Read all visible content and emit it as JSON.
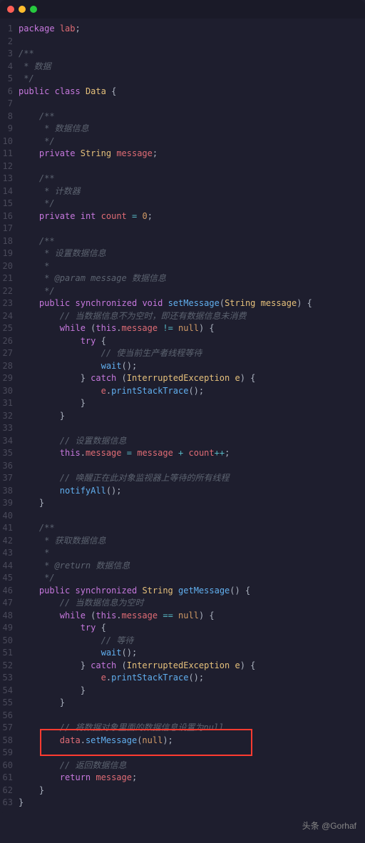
{
  "titlebar": {
    "close": "red",
    "min": "yellow",
    "max": "green"
  },
  "footer": {
    "source": "头条",
    "handle": "@Gorhaf"
  },
  "lines": [
    {
      "n": 1,
      "t": [
        [
          "kw",
          "package"
        ],
        [
          "",
          " "
        ],
        [
          "ident",
          "lab"
        ],
        [
          "punc",
          ";"
        ]
      ]
    },
    {
      "n": 2,
      "t": []
    },
    {
      "n": 3,
      "t": [
        [
          "cmt",
          "/**"
        ]
      ]
    },
    {
      "n": 4,
      "t": [
        [
          "cmt",
          " * 数据"
        ]
      ]
    },
    {
      "n": 5,
      "t": [
        [
          "cmt",
          " */"
        ]
      ]
    },
    {
      "n": 6,
      "t": [
        [
          "kw",
          "public"
        ],
        [
          "",
          " "
        ],
        [
          "kw",
          "class"
        ],
        [
          "",
          " "
        ],
        [
          "cls",
          "Data"
        ],
        [
          "punc",
          " {"
        ]
      ]
    },
    {
      "n": 7,
      "t": []
    },
    {
      "n": 8,
      "t": [
        [
          "",
          "    "
        ],
        [
          "cmt",
          "/**"
        ]
      ]
    },
    {
      "n": 9,
      "t": [
        [
          "",
          "    "
        ],
        [
          "cmt",
          " * 数据信息"
        ]
      ]
    },
    {
      "n": 10,
      "t": [
        [
          "",
          "    "
        ],
        [
          "cmt",
          " */"
        ]
      ]
    },
    {
      "n": 11,
      "t": [
        [
          "",
          "    "
        ],
        [
          "kw",
          "private"
        ],
        [
          "",
          " "
        ],
        [
          "typ",
          "String"
        ],
        [
          "",
          " "
        ],
        [
          "var",
          "message"
        ],
        [
          "punc",
          ";"
        ]
      ]
    },
    {
      "n": 12,
      "t": []
    },
    {
      "n": 13,
      "t": [
        [
          "",
          "    "
        ],
        [
          "cmt",
          "/**"
        ]
      ]
    },
    {
      "n": 14,
      "t": [
        [
          "",
          "    "
        ],
        [
          "cmt",
          " * 计数器"
        ]
      ]
    },
    {
      "n": 15,
      "t": [
        [
          "",
          "    "
        ],
        [
          "cmt",
          " */"
        ]
      ]
    },
    {
      "n": 16,
      "t": [
        [
          "",
          "    "
        ],
        [
          "kw",
          "private"
        ],
        [
          "",
          " "
        ],
        [
          "kw",
          "int"
        ],
        [
          "",
          " "
        ],
        [
          "var",
          "count"
        ],
        [
          "",
          " "
        ],
        [
          "op",
          "="
        ],
        [
          "",
          " "
        ],
        [
          "num",
          "0"
        ],
        [
          "punc",
          ";"
        ]
      ]
    },
    {
      "n": 17,
      "t": []
    },
    {
      "n": 18,
      "t": [
        [
          "",
          "    "
        ],
        [
          "cmt",
          "/**"
        ]
      ]
    },
    {
      "n": 19,
      "t": [
        [
          "",
          "    "
        ],
        [
          "cmt",
          " * 设置数据信息"
        ]
      ]
    },
    {
      "n": 20,
      "t": [
        [
          "",
          "    "
        ],
        [
          "cmt",
          " *"
        ]
      ]
    },
    {
      "n": 21,
      "t": [
        [
          "",
          "    "
        ],
        [
          "cmt",
          " * @param message 数据信息"
        ]
      ]
    },
    {
      "n": 22,
      "t": [
        [
          "",
          "    "
        ],
        [
          "cmt",
          " */"
        ]
      ]
    },
    {
      "n": 23,
      "t": [
        [
          "",
          "    "
        ],
        [
          "kw",
          "public"
        ],
        [
          "",
          " "
        ],
        [
          "kw",
          "synchronized"
        ],
        [
          "",
          " "
        ],
        [
          "kw",
          "void"
        ],
        [
          "",
          " "
        ],
        [
          "fn",
          "setMessage"
        ],
        [
          "punc",
          "("
        ],
        [
          "typ",
          "String"
        ],
        [
          "",
          " "
        ],
        [
          "param",
          "message"
        ],
        [
          "punc",
          ") {"
        ]
      ]
    },
    {
      "n": 24,
      "t": [
        [
          "",
          "        "
        ],
        [
          "cmt",
          "// 当数据信息不为空时，即还有数据信息未消费"
        ]
      ]
    },
    {
      "n": 25,
      "t": [
        [
          "",
          "        "
        ],
        [
          "kw",
          "while"
        ],
        [
          "",
          " "
        ],
        [
          "punc",
          "("
        ],
        [
          "kw",
          "this"
        ],
        [
          "punc",
          "."
        ],
        [
          "var",
          "message"
        ],
        [
          "",
          " "
        ],
        [
          "op",
          "!="
        ],
        [
          "",
          " "
        ],
        [
          "null",
          "null"
        ],
        [
          "punc",
          ") {"
        ]
      ]
    },
    {
      "n": 26,
      "t": [
        [
          "",
          "            "
        ],
        [
          "kw",
          "try"
        ],
        [
          "punc",
          " {"
        ]
      ]
    },
    {
      "n": 27,
      "t": [
        [
          "",
          "                "
        ],
        [
          "cmt",
          "// 使当前生产者线程等待"
        ]
      ]
    },
    {
      "n": 28,
      "t": [
        [
          "",
          "                "
        ],
        [
          "fn",
          "wait"
        ],
        [
          "punc",
          "();"
        ]
      ]
    },
    {
      "n": 29,
      "t": [
        [
          "",
          "            "
        ],
        [
          "punc",
          "} "
        ],
        [
          "kw",
          "catch"
        ],
        [
          "",
          " "
        ],
        [
          "punc",
          "("
        ],
        [
          "typ",
          "InterruptedException"
        ],
        [
          "",
          " "
        ],
        [
          "param",
          "e"
        ],
        [
          "punc",
          ") {"
        ]
      ]
    },
    {
      "n": 30,
      "t": [
        [
          "",
          "                "
        ],
        [
          "var",
          "e"
        ],
        [
          "punc",
          "."
        ],
        [
          "fn",
          "printStackTrace"
        ],
        [
          "punc",
          "();"
        ]
      ]
    },
    {
      "n": 31,
      "t": [
        [
          "",
          "            "
        ],
        [
          "punc",
          "}"
        ]
      ]
    },
    {
      "n": 32,
      "t": [
        [
          "",
          "        "
        ],
        [
          "punc",
          "}"
        ]
      ]
    },
    {
      "n": 33,
      "t": []
    },
    {
      "n": 34,
      "t": [
        [
          "",
          "        "
        ],
        [
          "cmt",
          "// 设置数据信息"
        ]
      ]
    },
    {
      "n": 35,
      "t": [
        [
          "",
          "        "
        ],
        [
          "kw",
          "this"
        ],
        [
          "punc",
          "."
        ],
        [
          "var",
          "message"
        ],
        [
          "",
          " "
        ],
        [
          "op",
          "="
        ],
        [
          "",
          " "
        ],
        [
          "var",
          "message"
        ],
        [
          "",
          " "
        ],
        [
          "op",
          "+"
        ],
        [
          "",
          " "
        ],
        [
          "var",
          "count"
        ],
        [
          "op",
          "++"
        ],
        [
          "punc",
          ";"
        ]
      ]
    },
    {
      "n": 36,
      "t": []
    },
    {
      "n": 37,
      "t": [
        [
          "",
          "        "
        ],
        [
          "cmt",
          "// 唤醒正在此对象监视器上等待的所有线程"
        ]
      ]
    },
    {
      "n": 38,
      "t": [
        [
          "",
          "        "
        ],
        [
          "fn",
          "notifyAll"
        ],
        [
          "punc",
          "();"
        ]
      ]
    },
    {
      "n": 39,
      "t": [
        [
          "",
          "    "
        ],
        [
          "punc",
          "}"
        ]
      ]
    },
    {
      "n": 40,
      "t": []
    },
    {
      "n": 41,
      "t": [
        [
          "",
          "    "
        ],
        [
          "cmt",
          "/**"
        ]
      ]
    },
    {
      "n": 42,
      "t": [
        [
          "",
          "    "
        ],
        [
          "cmt",
          " * 获取数据信息"
        ]
      ]
    },
    {
      "n": 43,
      "t": [
        [
          "",
          "    "
        ],
        [
          "cmt",
          " *"
        ]
      ]
    },
    {
      "n": 44,
      "t": [
        [
          "",
          "    "
        ],
        [
          "cmt",
          " * @return 数据信息"
        ]
      ]
    },
    {
      "n": 45,
      "t": [
        [
          "",
          "    "
        ],
        [
          "cmt",
          " */"
        ]
      ]
    },
    {
      "n": 46,
      "t": [
        [
          "",
          "    "
        ],
        [
          "kw",
          "public"
        ],
        [
          "",
          " "
        ],
        [
          "kw",
          "synchronized"
        ],
        [
          "",
          " "
        ],
        [
          "typ",
          "String"
        ],
        [
          "",
          " "
        ],
        [
          "fn",
          "getMessage"
        ],
        [
          "punc",
          "() {"
        ]
      ]
    },
    {
      "n": 47,
      "t": [
        [
          "",
          "        "
        ],
        [
          "cmt",
          "// 当数据信息为空时"
        ]
      ]
    },
    {
      "n": 48,
      "t": [
        [
          "",
          "        "
        ],
        [
          "kw",
          "while"
        ],
        [
          "",
          " "
        ],
        [
          "punc",
          "("
        ],
        [
          "kw",
          "this"
        ],
        [
          "punc",
          "."
        ],
        [
          "var",
          "message"
        ],
        [
          "",
          " "
        ],
        [
          "op",
          "=="
        ],
        [
          "",
          " "
        ],
        [
          "null",
          "null"
        ],
        [
          "punc",
          ") {"
        ]
      ]
    },
    {
      "n": 49,
      "t": [
        [
          "",
          "            "
        ],
        [
          "kw",
          "try"
        ],
        [
          "punc",
          " {"
        ]
      ]
    },
    {
      "n": 50,
      "t": [
        [
          "",
          "                "
        ],
        [
          "cmt",
          "// 等待"
        ]
      ]
    },
    {
      "n": 51,
      "t": [
        [
          "",
          "                "
        ],
        [
          "fn",
          "wait"
        ],
        [
          "punc",
          "();"
        ]
      ]
    },
    {
      "n": 52,
      "t": [
        [
          "",
          "            "
        ],
        [
          "punc",
          "} "
        ],
        [
          "kw",
          "catch"
        ],
        [
          "",
          " "
        ],
        [
          "punc",
          "("
        ],
        [
          "typ",
          "InterruptedException"
        ],
        [
          "",
          " "
        ],
        [
          "param",
          "e"
        ],
        [
          "punc",
          ") {"
        ]
      ]
    },
    {
      "n": 53,
      "t": [
        [
          "",
          "                "
        ],
        [
          "var",
          "e"
        ],
        [
          "punc",
          "."
        ],
        [
          "fn",
          "printStackTrace"
        ],
        [
          "punc",
          "();"
        ]
      ]
    },
    {
      "n": 54,
      "t": [
        [
          "",
          "            "
        ],
        [
          "punc",
          "}"
        ]
      ]
    },
    {
      "n": 55,
      "t": [
        [
          "",
          "        "
        ],
        [
          "punc",
          "}"
        ]
      ]
    },
    {
      "n": 56,
      "t": []
    },
    {
      "n": 57,
      "t": [
        [
          "",
          "        "
        ],
        [
          "cmt",
          "// 将数据对象里面的数据信息设置为null"
        ]
      ]
    },
    {
      "n": 58,
      "t": [
        [
          "",
          "        "
        ],
        [
          "var",
          "data"
        ],
        [
          "punc",
          "."
        ],
        [
          "fn",
          "setMessage"
        ],
        [
          "punc",
          "("
        ],
        [
          "null",
          "null"
        ],
        [
          "punc",
          ");"
        ]
      ]
    },
    {
      "n": 59,
      "t": []
    },
    {
      "n": 60,
      "t": [
        [
          "",
          "        "
        ],
        [
          "cmt",
          "// 返回数据信息"
        ]
      ]
    },
    {
      "n": 61,
      "t": [
        [
          "",
          "        "
        ],
        [
          "kw",
          "return"
        ],
        [
          "",
          " "
        ],
        [
          "var",
          "message"
        ],
        [
          "punc",
          ";"
        ]
      ]
    },
    {
      "n": 62,
      "t": [
        [
          "",
          "    "
        ],
        [
          "punc",
          "}"
        ]
      ]
    },
    {
      "n": 63,
      "t": [
        [
          "punc",
          "}"
        ]
      ]
    }
  ]
}
